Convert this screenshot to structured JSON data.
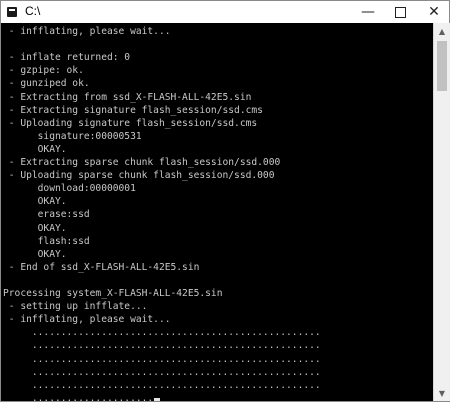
{
  "window": {
    "title": "C:\\",
    "minimize_glyph": "—",
    "close_glyph": "✕"
  },
  "console": {
    "lines": [
      " - infflating, please wait...",
      "",
      " - inflate returned: 0",
      " - gzpipe: ok.",
      " - gunziped ok.",
      " - Extracting from ssd_X-FLASH-ALL-42E5.sin",
      " - Extracting signature flash_session/ssd.cms",
      " - Uploading signature flash_session/ssd.cms",
      "      signature:00000531",
      "      OKAY.",
      " - Extracting sparse chunk flash_session/ssd.000",
      " - Uploading sparse chunk flash_session/ssd.000",
      "      download:00000001",
      "      OKAY.",
      "      erase:ssd",
      "      OKAY.",
      "      flash:ssd",
      "      OKAY.",
      " - End of ssd_X-FLASH-ALL-42E5.sin",
      "",
      "Processing system_X-FLASH-ALL-42E5.sin",
      " - setting up infflate...",
      " - infflating, please wait...",
      "     ..................................................",
      "     ..................................................",
      "     ..................................................",
      "     ..................................................",
      "     ..................................................",
      "     ....................."
    ]
  }
}
